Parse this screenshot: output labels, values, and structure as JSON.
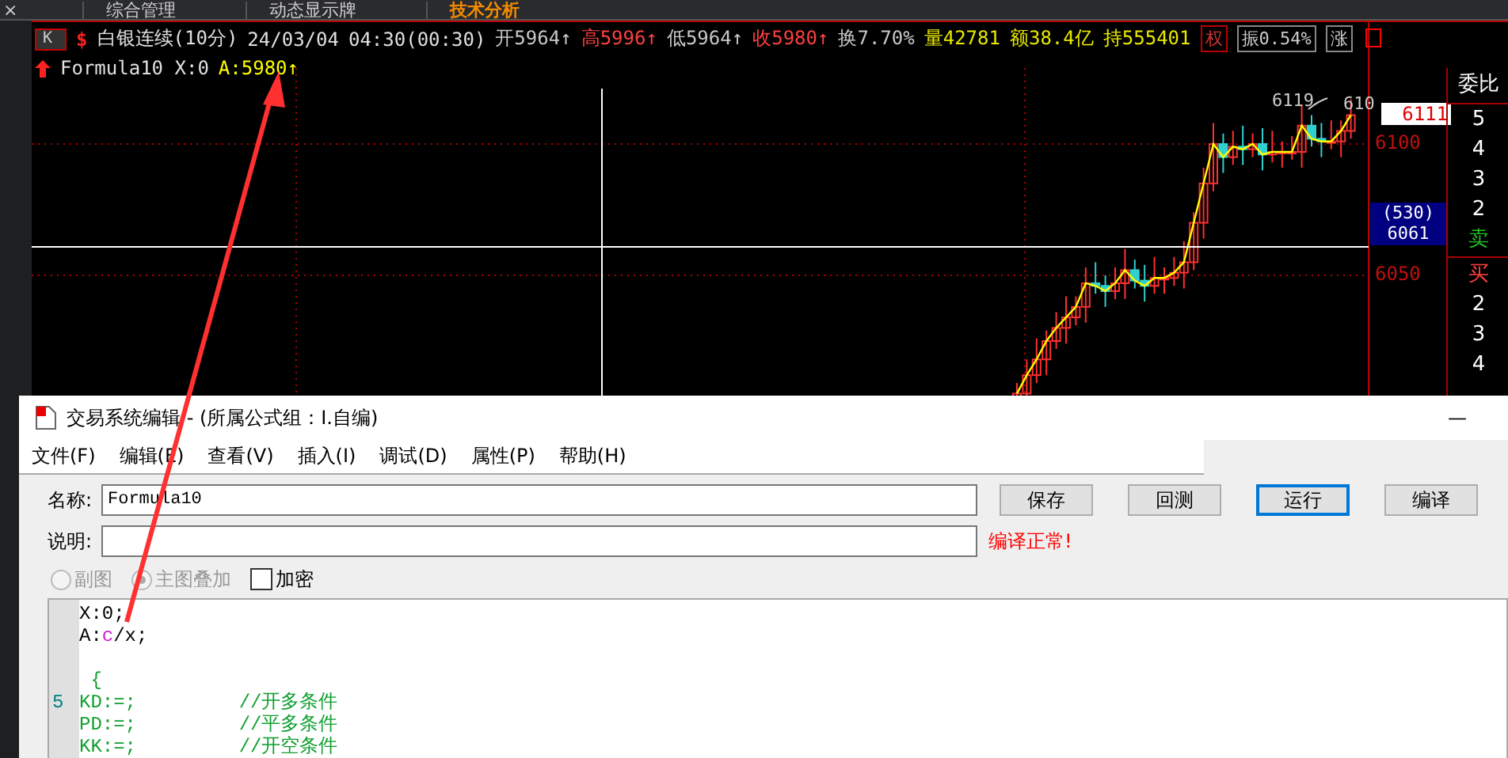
{
  "top_tabs": [
    {
      "label": "综合管理",
      "selected": false
    },
    {
      "label": "动态显示牌",
      "selected": false
    },
    {
      "label": "技术分析",
      "selected": true
    }
  ],
  "close_glyph": "×",
  "quote_header": {
    "period_button": "K",
    "symbol_glyph": "$",
    "title": "白银连续(10分)",
    "date": "24/03/04",
    "time": "04:30(00:30)",
    "fields": [
      {
        "label": "开",
        "value": "5964",
        "arrow": "↑",
        "color": "#c8c8c8"
      },
      {
        "label": "高",
        "value": "5996",
        "arrow": "↑",
        "color": "#ff4040"
      },
      {
        "label": "低",
        "value": "5964",
        "arrow": "↑",
        "color": "#c8c8c8"
      },
      {
        "label": "收",
        "value": "5980",
        "arrow": "↑",
        "color": "#ff4040"
      },
      {
        "label": "换",
        "value": "7.70%",
        "color": "#c8c8c8"
      },
      {
        "label": "量",
        "value": "42781",
        "color": "#e8e800"
      },
      {
        "label": "额",
        "value": "38.4亿",
        "color": "#e8e800"
      },
      {
        "label": "持",
        "value": "555401",
        "color": "#e8e800"
      }
    ],
    "mini_buttons": [
      {
        "label": "权",
        "kind": "red"
      },
      {
        "label": "振0.54%",
        "kind": "gray"
      },
      {
        "label": "涨",
        "kind": "gray"
      }
    ]
  },
  "indicator_line": {
    "name": "Formula10 X:0",
    "value": "A:5980↑"
  },
  "price_axis": {
    "ticks": [
      "6100",
      "6050"
    ],
    "last_price": "6111",
    "high_label": "6119",
    "cut_label": "610",
    "cursor_box": [
      "(530)",
      "6061"
    ]
  },
  "order_panel": {
    "title": "委比",
    "rows": [
      {
        "text": "5",
        "kind": "level"
      },
      {
        "text": "4",
        "kind": "level"
      },
      {
        "text": "3",
        "kind": "level"
      },
      {
        "text": "2",
        "kind": "level"
      },
      {
        "text": "卖",
        "kind": "sell"
      },
      {
        "text": "买",
        "kind": "buy"
      },
      {
        "text": "2",
        "kind": "level"
      },
      {
        "text": "3",
        "kind": "level"
      },
      {
        "text": "4",
        "kind": "level"
      }
    ]
  },
  "dialog": {
    "title": "交易系统编辑 - (所属公式组：I.自编)",
    "minimize_glyph": "—",
    "menu": [
      "文件(F)",
      "编辑(E)",
      "查看(V)",
      "插入(I)",
      "调试(D)",
      "属性(P)",
      "帮助(H)"
    ],
    "name_label": "名称:",
    "name_value": "Formula10",
    "desc_label": "说明:",
    "buttons": [
      {
        "label": "保存",
        "default": false
      },
      {
        "label": "回测",
        "default": false
      },
      {
        "label": "运行",
        "default": true
      },
      {
        "label": "编译",
        "default": false
      }
    ],
    "status": "编译正常!",
    "radios": [
      {
        "label": "副图",
        "selected": false,
        "disabled": true
      },
      {
        "label": "主图叠加",
        "selected": true,
        "disabled": true
      }
    ],
    "checkbox": {
      "label": "加密",
      "checked": false
    },
    "code_lines": [
      {
        "kind": "code",
        "segments": [
          {
            "text": "X:0;",
            "kind": "plain"
          }
        ]
      },
      {
        "kind": "code",
        "segments": [
          {
            "text": "A:",
            "kind": "plain"
          },
          {
            "text": "c",
            "kind": "variable"
          },
          {
            "text": "/x;",
            "kind": "plain"
          }
        ]
      },
      {
        "kind": "blank"
      },
      {
        "kind": "code",
        "segments": [
          {
            "text": " {",
            "kind": "green"
          }
        ]
      },
      {
        "kind": "code",
        "number": "5",
        "segments": [
          {
            "text": "KD:=;         //开多条件",
            "kind": "green"
          }
        ]
      },
      {
        "kind": "code",
        "segments": [
          {
            "text": "PD:=;         //平多条件",
            "kind": "green"
          }
        ]
      },
      {
        "kind": "code",
        "segments": [
          {
            "text": "KK:=;         //开空条件",
            "kind": "green"
          }
        ]
      }
    ]
  }
}
